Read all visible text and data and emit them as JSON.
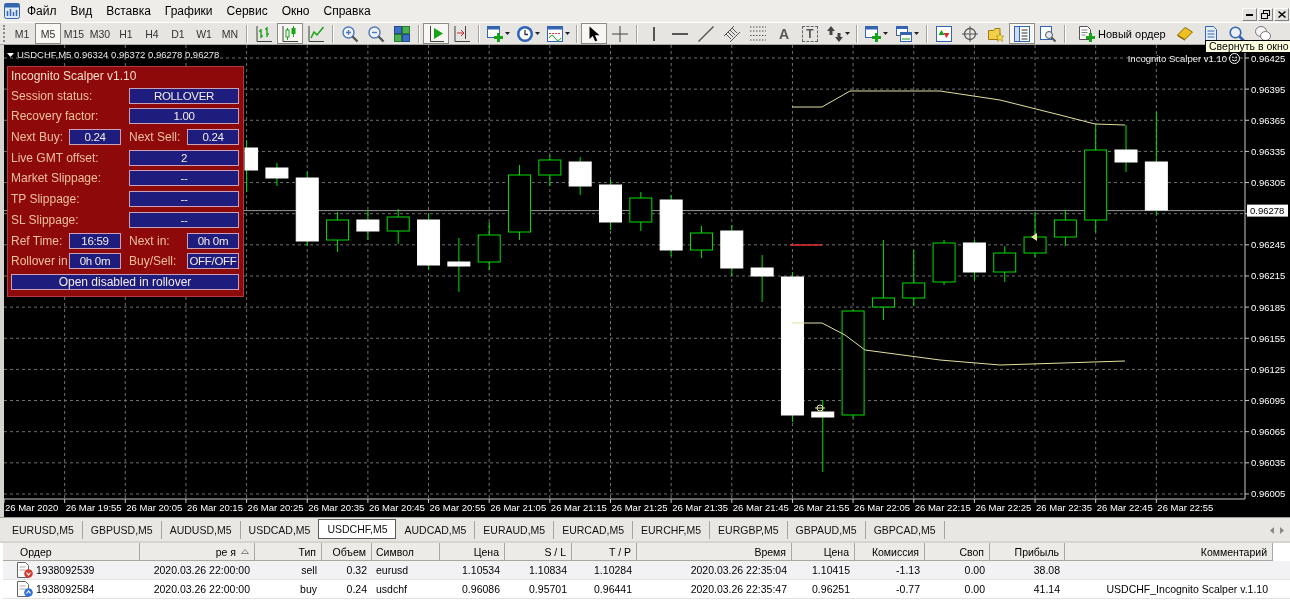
{
  "menu": {
    "items": [
      "Файл",
      "Вид",
      "Вставка",
      "Графики",
      "Сервис",
      "Окно",
      "Справка"
    ]
  },
  "toolbar": {
    "timeframes": [
      {
        "label": "M1",
        "selected": false
      },
      {
        "label": "M5",
        "selected": true
      },
      {
        "label": "M15",
        "selected": false
      },
      {
        "label": "M30",
        "selected": false
      },
      {
        "label": "H1",
        "selected": false
      },
      {
        "label": "H4",
        "selected": false
      },
      {
        "label": "D1",
        "selected": false
      },
      {
        "label": "W1",
        "selected": false
      },
      {
        "label": "MN",
        "selected": false
      }
    ],
    "chart_types": [
      {
        "selected": false
      },
      {
        "selected": true
      },
      {
        "selected": false
      }
    ],
    "auto_scroll": {
      "on": true
    },
    "chart_shift": {
      "on": false
    },
    "cursor_modes": [
      {
        "selected": true
      },
      {
        "selected": false
      }
    ],
    "text_tool": "A",
    "label_tool": "T",
    "data_window": {
      "on": true
    },
    "new_order_button": "Новый ордер"
  },
  "tooltip": "Свернуть в окно",
  "chart": {
    "symbol": "USDCHF,M5",
    "ohlc": [
      "0.96324",
      "0.96372",
      "0.96278",
      "0.96278"
    ],
    "indicator_label": "Incognito Scalper v1.10",
    "price_ticks": [
      "0.96425",
      "0.96395",
      "0.96365",
      "0.96335",
      "0.96305",
      "0.96245",
      "0.96215",
      "0.96185",
      "0.96155",
      "0.96125",
      "0.96095",
      "0.96065",
      "0.96035",
      "0.96005"
    ],
    "current_price": "0.96278",
    "time_ticks": [
      "26 Mar 2020",
      "26 Mar 19:55",
      "26 Mar 20:05",
      "26 Mar 20:15",
      "26 Mar 20:25",
      "26 Mar 20:35",
      "26 Mar 20:45",
      "26 Mar 20:55",
      "26 Mar 21:05",
      "26 Mar 21:15",
      "26 Mar 21:25",
      "26 Mar 21:35",
      "26 Mar 21:45",
      "26 Mar 21:55",
      "26 Mar 22:05",
      "26 Mar 22:15",
      "26 Mar 22:25",
      "26 Mar 22:35",
      "26 Mar 22:45",
      "26 Mar 22:55"
    ]
  },
  "scalper_panel": {
    "title": "Incognito Scalper v1.10",
    "rows": [
      {
        "kind": "wide",
        "label": "Session status:",
        "value": "ROLLOVER"
      },
      {
        "kind": "wide",
        "label": "Recovery factor:",
        "value": "1.00"
      },
      {
        "kind": "pair",
        "fields": [
          {
            "label": "Next Buy:",
            "value": "0.24"
          },
          {
            "label": "Next Sell:",
            "value": "0.24"
          }
        ]
      },
      {
        "kind": "wide",
        "label": "Live GMT offset:",
        "value": "2"
      },
      {
        "kind": "wide",
        "label": "Market Slippage:",
        "value": "--"
      },
      {
        "kind": "wide",
        "label": "TP Slippage:",
        "value": "--"
      },
      {
        "kind": "wide",
        "label": "SL Slippage:",
        "value": "--"
      },
      {
        "kind": "pair",
        "fields": [
          {
            "label": "Ref Time:",
            "value": "16:59"
          },
          {
            "label": "Next in:",
            "value": "0h 0m"
          }
        ]
      },
      {
        "kind": "pair",
        "fields": [
          {
            "label": "Rollover in",
            "value": "0h 0m"
          },
          {
            "label": "Buy/Sell:",
            "value": "OFF/OFF"
          }
        ]
      },
      {
        "kind": "banner",
        "value": "Open disabled in rollover"
      }
    ]
  },
  "tabs": [
    {
      "label": "EURUSD,M5",
      "selected": false
    },
    {
      "label": "GBPUSD,M5",
      "selected": false
    },
    {
      "label": "AUDUSD,M5",
      "selected": false
    },
    {
      "label": "USDCAD,M5",
      "selected": false
    },
    {
      "label": "USDCHF,M5",
      "selected": true
    },
    {
      "label": "AUDCAD,M5",
      "selected": false
    },
    {
      "label": "EURAUD,M5",
      "selected": false
    },
    {
      "label": "EURCAD,M5",
      "selected": false
    },
    {
      "label": "EURCHF,M5",
      "selected": false
    },
    {
      "label": "EURGBP,M5",
      "selected": false
    },
    {
      "label": "GBPAUD,M5",
      "selected": false
    },
    {
      "label": "GBPCAD,M5",
      "selected": false
    }
  ],
  "orders": {
    "columns": [
      {
        "label": "Ордер",
        "sorted": false
      },
      {
        "label": "ре я",
        "sorted": true
      },
      {
        "label": "Тип",
        "sorted": false
      },
      {
        "label": "Объем",
        "sorted": false
      },
      {
        "label": "Символ",
        "sorted": false
      },
      {
        "label": "Цена",
        "sorted": false
      },
      {
        "label": "S / L",
        "sorted": false
      },
      {
        "label": "T / P",
        "sorted": false
      },
      {
        "label": "Время",
        "sorted": false
      },
      {
        "label": "Цена",
        "sorted": false
      },
      {
        "label": "Комиссия",
        "sorted": false
      },
      {
        "label": "Своп",
        "sorted": false
      },
      {
        "label": "Прибыль",
        "sorted": false
      },
      {
        "label": "Комментарий",
        "sorted": false
      }
    ],
    "rows": [
      {
        "kind": "sell",
        "cells": [
          "1938092539",
          "2020.03.26 22:00:00",
          "sell",
          "0.32",
          "eurusd",
          "1.10534",
          "1.10834",
          "1.10284",
          "2020.03.26 22:35:04",
          "1.10415",
          "-1.13",
          "0.00",
          "38.08"
        ]
      },
      {
        "kind": "buy",
        "cells": [
          "1938092584",
          "2020.03.26 22:00:00",
          "buy",
          "0.24",
          "usdchf",
          "0.96086",
          "0.95701",
          "0.96441",
          "2020.03.26 22:35:47",
          "0.96251",
          "-0.77",
          "0.00",
          "41.14",
          "USDCHF_Incognito Scalper v.1.10"
        ]
      }
    ]
  }
}
